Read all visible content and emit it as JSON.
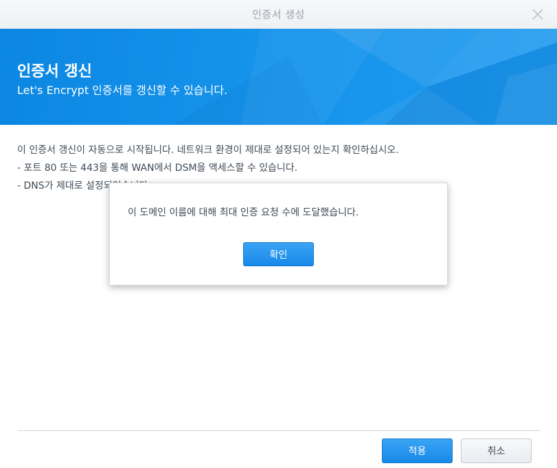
{
  "window": {
    "title": "인증서 생성"
  },
  "banner": {
    "title": "인증서 갱신",
    "subtitle": "Let's Encrypt 인증서를 갱신할 수 있습니다."
  },
  "content": {
    "lines": [
      "이 인증서 갱신이 자동으로 시작됩니다. 네트워크 환경이 제대로 설정되어 있는지 확인하십시오.",
      "- 포트 80 또는 443을 통해 WAN에서 DSM을 액세스할 수 있습니다.",
      "- DNS가 제대로 설정되었습니다."
    ]
  },
  "modal": {
    "message": "이 도메인 이름에 대해 최대 인증 요청 수에 도달했습니다.",
    "ok_label": "확인"
  },
  "footer": {
    "apply_label": "적용",
    "cancel_label": "취소"
  },
  "colors": {
    "accent": "#1889e9",
    "banner": "#0b87e2"
  },
  "icons": {
    "close": "close-icon"
  }
}
